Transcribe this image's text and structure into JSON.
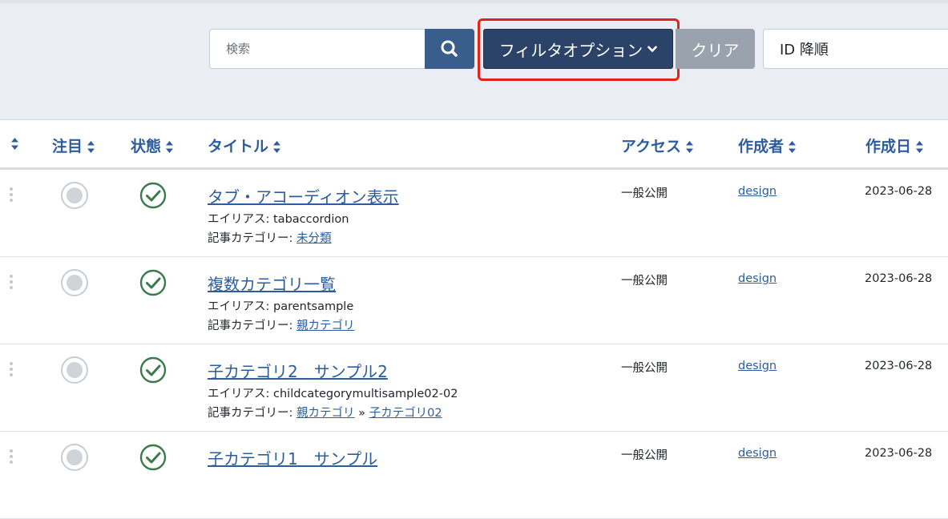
{
  "toolbar": {
    "search_placeholder": "検索",
    "filter_label": "フィルタオプション",
    "clear_label": "クリア",
    "sort_value": "ID 降順"
  },
  "columns": {
    "featured": "注目",
    "status": "状態",
    "title": "タイトル",
    "access": "アクセス",
    "author": "作成者",
    "created": "作成日"
  },
  "colors": {
    "accent": "#2d5d9c",
    "filter_button": "#2b4369",
    "highlight": "#e2231a",
    "published_check": "#3a7a4a"
  },
  "labels": {
    "alias_prefix": "エイリアス: ",
    "category_prefix": "記事カテゴリー: ",
    "category_separator": " » "
  },
  "rows": [
    {
      "title": "タブ・アコーディオン表示",
      "alias": "tabaccordion",
      "category": "未分類",
      "subcategory": "",
      "access": "一般公開",
      "author": "design",
      "created": "2023-06-28"
    },
    {
      "title": "複数カテゴリ一覧",
      "alias": "parentsample",
      "category": "親カテゴリ",
      "subcategory": "",
      "access": "一般公開",
      "author": "design",
      "created": "2023-06-28"
    },
    {
      "title": "子カテゴリ2　サンプル2",
      "alias": "childcategorymultisample02-02",
      "category": "親カテゴリ",
      "subcategory": "子カテゴリ02",
      "access": "一般公開",
      "author": "design",
      "created": "2023-06-28"
    },
    {
      "title": "子カテゴリ1　サンプル",
      "alias": "",
      "category": "",
      "subcategory": "",
      "access": "一般公開",
      "author": "design",
      "created": "2023-06-28"
    }
  ]
}
